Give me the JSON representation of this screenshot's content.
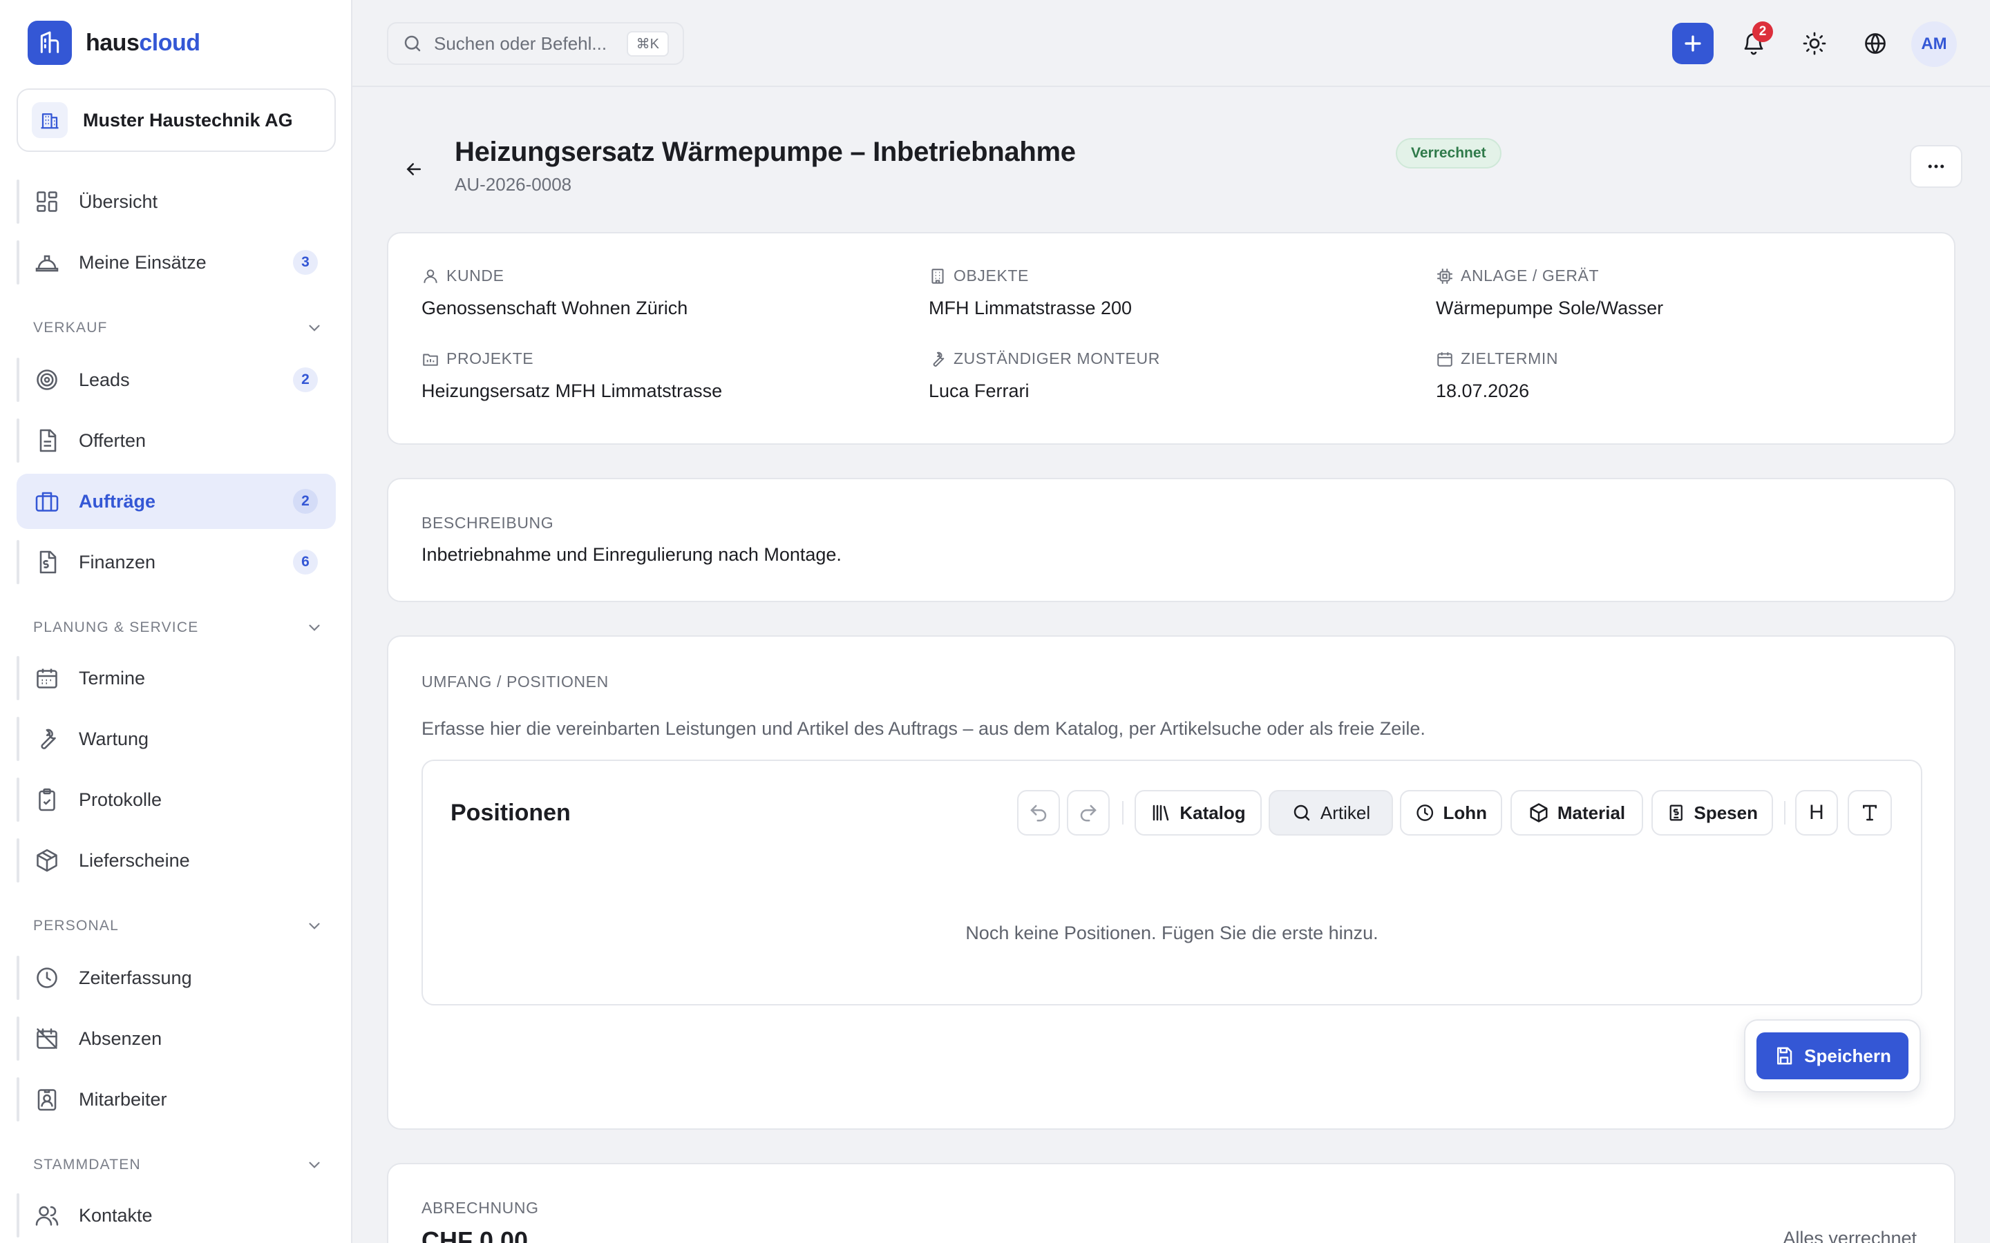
{
  "brand": {
    "name_part1": "haus",
    "name_part2": "cloud"
  },
  "tenant": {
    "name": "Muster Haustechnik AG"
  },
  "sidebar": {
    "top_items": [
      {
        "label": "Übersicht"
      },
      {
        "label": "Meine Einsätze",
        "badge": "3"
      }
    ],
    "sections": [
      {
        "title": "VERKAUF",
        "items": [
          {
            "label": "Leads",
            "badge": "2"
          },
          {
            "label": "Offerten"
          },
          {
            "label": "Aufträge",
            "badge": "2",
            "active": true
          },
          {
            "label": "Finanzen",
            "badge": "6"
          }
        ]
      },
      {
        "title": "PLANUNG & SERVICE",
        "items": [
          {
            "label": "Termine"
          },
          {
            "label": "Wartung"
          },
          {
            "label": "Protokolle"
          },
          {
            "label": "Lieferscheine"
          }
        ]
      },
      {
        "title": "PERSONAL",
        "items": [
          {
            "label": "Zeiterfassung"
          },
          {
            "label": "Absenzen"
          },
          {
            "label": "Mitarbeiter"
          }
        ]
      },
      {
        "title": "STAMMDATEN",
        "items": [
          {
            "label": "Kontakte"
          }
        ]
      }
    ]
  },
  "topbar": {
    "search_placeholder": "Suchen oder Befehl...",
    "search_shortcut": "⌘K",
    "notification_count": "2",
    "avatar_initials": "AM"
  },
  "order": {
    "title": "Heizungsersatz Wärmepumpe – Inbetriebnahme",
    "status": "Verrechnet",
    "number": "AU-2026-0008"
  },
  "info": {
    "kunde": {
      "label": "KUNDE",
      "value": "Genossenschaft Wohnen Zürich"
    },
    "objekte": {
      "label": "OBJEKTE",
      "value": "MFH Limmatstrasse 200"
    },
    "anlage": {
      "label": "ANLAGE / GERÄT",
      "value": "Wärmepumpe Sole/Wasser"
    },
    "projekte": {
      "label": "PROJEKTE",
      "value": "Heizungsersatz MFH Limmatstrasse"
    },
    "monteur": {
      "label": "ZUSTÄNDIGER MONTEUR",
      "value": "Luca Ferrari"
    },
    "zieltermin": {
      "label": "ZIELTERMIN",
      "value": "18.07.2026"
    }
  },
  "beschreibung": {
    "label": "BESCHREIBUNG",
    "text": "Inbetriebnahme und Einregulierung nach Montage."
  },
  "umfang": {
    "label": "UMFANG / POSITIONEN",
    "hint": "Erfasse hier die vereinbarten Leistungen und Artikel des Auftrags – aus dem Katalog, per Artikelsuche oder als freie Zeile.",
    "positions_title": "Positionen",
    "toolbar": {
      "katalog": "Katalog",
      "artikel": "Artikel",
      "lohn": "Lohn",
      "material": "Material",
      "spesen": "Spesen",
      "heading": "H",
      "text": "T"
    },
    "empty": "Noch keine Positionen. Fügen Sie die erste hinzu.",
    "save": "Speichern"
  },
  "abrechnung": {
    "label": "ABRECHNUNG",
    "amount": "CHF 0.00",
    "status": "Alles verrechnet"
  },
  "colors": {
    "accent": "#3457d5",
    "success": "#2f7a4a",
    "danger": "#dc2f3b"
  }
}
